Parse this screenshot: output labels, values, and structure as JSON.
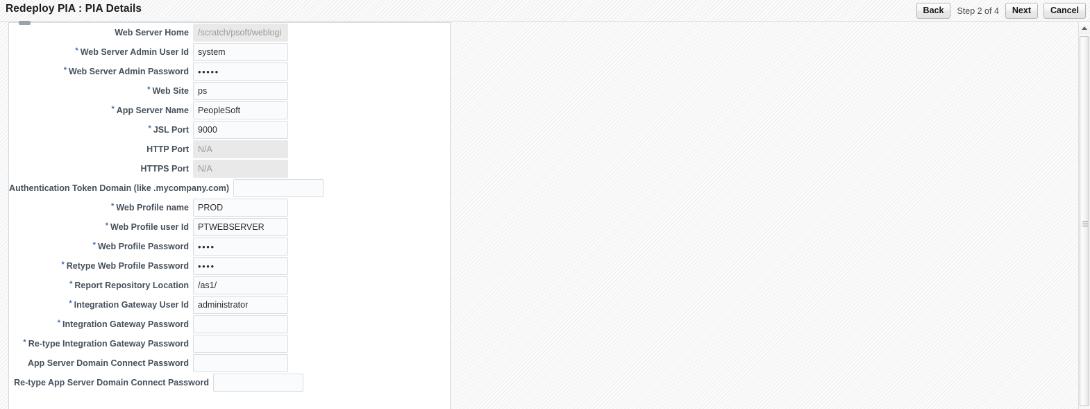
{
  "header": {
    "title": "Redeploy PIA : PIA Details",
    "back_label": "Back",
    "step_label": "Step 2 of 4",
    "next_label": "Next",
    "cancel_label": "Cancel"
  },
  "colors": {
    "required_star": "#3c6bb0",
    "label_text": "#46505c",
    "field_border": "#d7dee4",
    "disabled_bg": "#e9e9e9"
  },
  "form": {
    "required_marker": "*",
    "fields": [
      {
        "label": "Web Server Home",
        "required": false,
        "value": "/scratch/psoft/weblogi",
        "disabled": true,
        "type": "text",
        "width": "normal"
      },
      {
        "label": "Web Server Admin User Id",
        "required": true,
        "value": "system",
        "disabled": false,
        "type": "text",
        "width": "normal"
      },
      {
        "label": "Web Server Admin Password",
        "required": true,
        "value": "•••••",
        "disabled": false,
        "type": "password",
        "width": "normal"
      },
      {
        "label": "Web Site",
        "required": true,
        "value": "ps",
        "disabled": false,
        "type": "text",
        "width": "normal"
      },
      {
        "label": "App Server Name",
        "required": true,
        "value": "PeopleSoft",
        "disabled": false,
        "type": "text",
        "width": "normal"
      },
      {
        "label": "JSL Port",
        "required": true,
        "value": "9000",
        "disabled": false,
        "type": "text",
        "width": "normal"
      },
      {
        "label": "HTTP Port",
        "required": false,
        "value": "N/A",
        "disabled": true,
        "type": "text",
        "width": "normal"
      },
      {
        "label": "HTTPS Port",
        "required": false,
        "value": "N/A",
        "disabled": true,
        "type": "text",
        "width": "normal"
      },
      {
        "label": "Authentication Token Domain (like .mycompany.com)",
        "required": false,
        "value": "",
        "disabled": false,
        "type": "text",
        "width": "wide"
      },
      {
        "label": "Web Profile name",
        "required": true,
        "value": "PROD",
        "disabled": false,
        "type": "text",
        "width": "normal"
      },
      {
        "label": "Web Profile user Id",
        "required": true,
        "value": "PTWEBSERVER",
        "disabled": false,
        "type": "text",
        "width": "normal"
      },
      {
        "label": "Web Profile Password",
        "required": true,
        "value": "••••",
        "disabled": false,
        "type": "password",
        "width": "normal"
      },
      {
        "label": "Retype Web Profile Password",
        "required": true,
        "value": "••••",
        "disabled": false,
        "type": "password",
        "width": "normal"
      },
      {
        "label": "Report Repository Location",
        "required": true,
        "value": "/as1/",
        "disabled": false,
        "type": "text",
        "width": "normal"
      },
      {
        "label": "Integration Gateway User Id",
        "required": true,
        "value": "administrator",
        "disabled": false,
        "type": "text",
        "width": "normal"
      },
      {
        "label": "Integration Gateway Password",
        "required": true,
        "value": "",
        "disabled": false,
        "type": "password",
        "width": "normal"
      },
      {
        "label": "Re-type Integration Gateway Password",
        "required": true,
        "value": "",
        "disabled": false,
        "type": "password",
        "width": "normal"
      },
      {
        "label": "App Server Domain Connect Password",
        "required": false,
        "value": "",
        "disabled": false,
        "type": "password",
        "width": "normal"
      },
      {
        "label": "Re-type App Server Domain Connect Password",
        "required": false,
        "value": "",
        "disabled": false,
        "type": "password",
        "width": "wide2"
      }
    ]
  },
  "scrollbar": {
    "up_arrow": "scroll-up-arrow",
    "thumb": "scroll-thumb"
  }
}
